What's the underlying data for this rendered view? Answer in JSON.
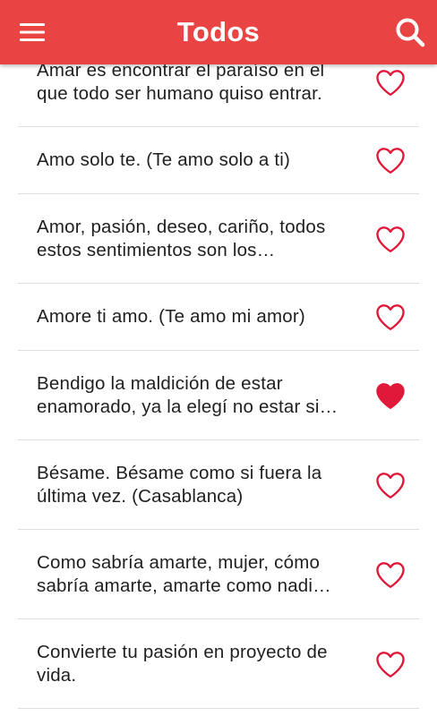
{
  "appbar": {
    "title": "Todos",
    "menu_icon": "hamburger-menu-icon",
    "search_icon": "search-icon",
    "color": "#e94344"
  },
  "quotes": [
    {
      "text": "Amar es encontrar el paraíso en el que todo ser humano quiso entrar.",
      "favorite": false
    },
    {
      "text": "Amo solo te. (Te amo solo a ti)",
      "favorite": false
    },
    {
      "text": "Amor, pasión, deseo, cariño, todos estos sentimientos son los…",
      "favorite": false
    },
    {
      "text": "Amore ti amo. (Te amo mi amor)",
      "favorite": false
    },
    {
      "text": "Bendigo la maldición de estar enamorado, ya la elegí no estar si…",
      "favorite": true
    },
    {
      "text": "Bésame. Bésame como si fuera la última vez. (Casablanca)",
      "favorite": false
    },
    {
      "text": "Como sabría amarte, mujer, cómo sabría amarte, amarte como nadi…",
      "favorite": false
    },
    {
      "text": "Convierte tu pasión en proyecto de vida.",
      "favorite": false
    }
  ],
  "colors": {
    "accent": "#e0193a",
    "text": "#1f1f1f",
    "divider": "#e0e0e0"
  }
}
